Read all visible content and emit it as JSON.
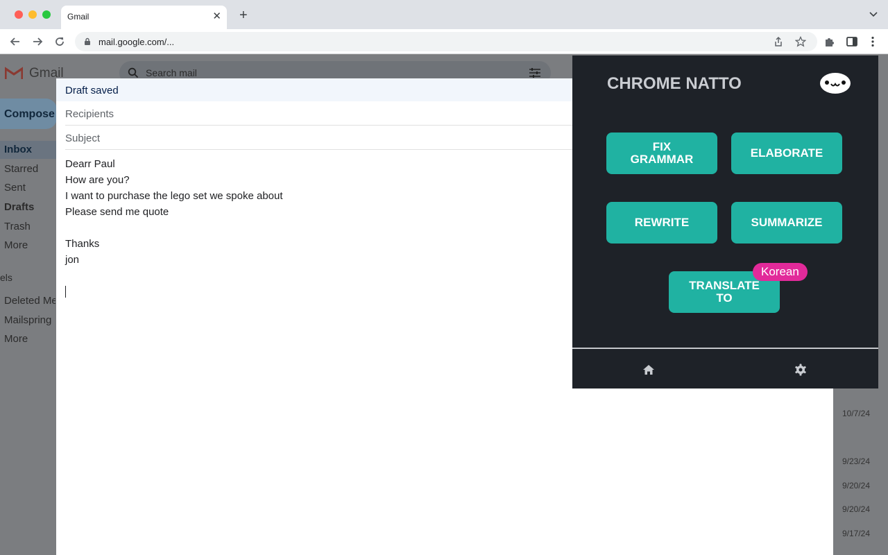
{
  "browser": {
    "tab_title": "Gmail",
    "tab_close": "✕",
    "new_tab": "+",
    "url": "mail.google.com/..."
  },
  "gmail": {
    "logo_text": "Gmail",
    "search_placeholder": "Search mail",
    "compose_label": "Compose",
    "nav": [
      "Inbox",
      "Starred",
      "Sent",
      "Drafts",
      "Trash",
      "More"
    ],
    "labels_header": "els",
    "labels": [
      "Deleted Me",
      "Mailspring",
      "More"
    ],
    "dates": [
      "10/7/24",
      "9/23/24",
      "9/20/24",
      "9/20/24",
      "9/17/24"
    ]
  },
  "compose": {
    "status": "Draft saved",
    "recipients_placeholder": "Recipients",
    "subject_placeholder": "Subject",
    "body_lines": [
      "Dearr Paul",
      "How are you?",
      "I want to purchase the lego set we spoke about",
      "Please send me quote",
      "",
      "Thanks",
      "jon"
    ]
  },
  "natto": {
    "title": "CHROME NATTO",
    "buttons": {
      "fix_grammar": "FIX GRAMMAR",
      "elaborate": "ELABORATE",
      "rewrite": "REWRITE",
      "summarize": "SUMMARIZE",
      "translate": "TRANSLATE TO"
    },
    "language": "Korean",
    "accent_color": "#20b2a2",
    "badge_color": "#e22a9a",
    "icons": [
      "natto-logo-icon",
      "home-icon",
      "gear-icon"
    ]
  }
}
